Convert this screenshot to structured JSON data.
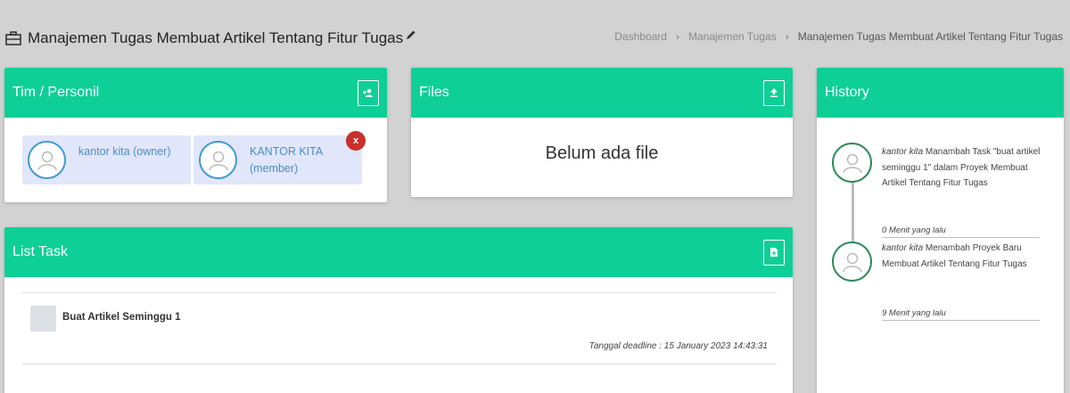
{
  "header": {
    "title": "Manajemen Tugas Membuat Artikel Tentang Fitur Tugas",
    "title_icon": "briefcase-icon",
    "edit_icon": "pencil-icon"
  },
  "breadcrumb": [
    "Dashboard",
    "Manajemen Tugas",
    "Manajemen Tugas Membuat Artikel Tentang Fitur Tugas"
  ],
  "team": {
    "title": "Tim / Personil",
    "add_icon": "add-user-icon",
    "members": [
      {
        "name": "kantor kita (owner)"
      },
      {
        "name": "KANTOR KITA (member)",
        "remove_label": "x"
      }
    ]
  },
  "files": {
    "title": "Files",
    "upload_icon": "upload-icon",
    "empty_text": "Belum ada file"
  },
  "history": {
    "title": "History",
    "items": [
      {
        "user": "kantor kita",
        "text": " Manambah Task \"buat artikel seminggu 1\" dalam Proyek Membuat Artikel Tentang Fitur Tugas",
        "time": "0 Menit yang lalu"
      },
      {
        "user": "kantor kita",
        "text": " Menambah Proyek Baru Membuat Artikel Tentang Fitur Tugas",
        "time": "9 Menit yang lalu"
      }
    ]
  },
  "tasks": {
    "title": "List Task",
    "add_icon": "add-file-icon",
    "items": [
      {
        "name": "Buat Artikel Seminggu 1",
        "deadline": "Tanggal deadline : 15 January 2023 14:43:31"
      }
    ]
  },
  "colors": {
    "accent": "#0ecf96",
    "member_bg": "#e1e6fa",
    "remove": "#c9302c"
  }
}
